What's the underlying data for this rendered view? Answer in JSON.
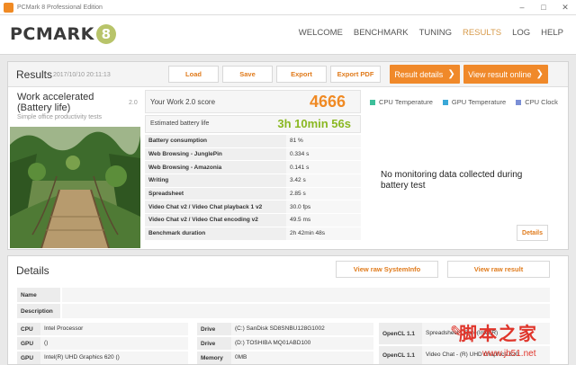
{
  "window": {
    "title": "PCMark 8 Professional Edition",
    "minimize": "–",
    "maximize": "□",
    "close": "✕"
  },
  "header": {
    "logo_text": "PCMARK",
    "logo_number": "8",
    "nav": [
      "WELCOME",
      "BENCHMARK",
      "TUNING",
      "RESULTS",
      "LOG",
      "HELP"
    ],
    "active_nav": "RESULTS"
  },
  "results": {
    "title": "Results",
    "date": "2017/10/10 20:11:13",
    "buttons": {
      "load": "Load",
      "save": "Save",
      "export": "Export",
      "export_pdf": "Export PDF",
      "result_details": "Result details",
      "view_online": "View result online"
    },
    "test_title": "Work accelerated (Battery life)",
    "test_version": "2.0",
    "test_subtitle": "Simple office productivity tests",
    "score_label": "Your Work 2.0 score",
    "score_value": "4666",
    "battery_label": "Estimated battery life",
    "battery_value": "3h 10min 56s",
    "metrics": [
      {
        "name": "Battery consumption",
        "value": "81 %"
      },
      {
        "name": "Web Browsing - JunglePin",
        "value": "0.334 s"
      },
      {
        "name": "Web Browsing - Amazonia",
        "value": "0.141 s"
      },
      {
        "name": "Writing",
        "value": "3.42 s"
      },
      {
        "name": "Spreadsheet",
        "value": "2.85 s"
      },
      {
        "name": "Video Chat v2 / Video Chat playback 1 v2",
        "value": "30.0 fps"
      },
      {
        "name": "Video Chat v2 / Video Chat encoding v2",
        "value": "49.5 ms"
      },
      {
        "name": "Benchmark duration",
        "value": "2h 42min 48s"
      }
    ],
    "legend": [
      {
        "label": "CPU Temperature",
        "color": "#3dbf9a"
      },
      {
        "label": "GPU Temperature",
        "color": "#3aa8d8"
      },
      {
        "label": "CPU Clock",
        "color": "#7b8fd6"
      }
    ],
    "no_monitoring": "No monitoring data collected during battery test",
    "details_button": "Details"
  },
  "details": {
    "title": "Details",
    "view_sysinfo": "View raw SystemInfo",
    "view_result": "View raw result",
    "name_label": "Name",
    "description_label": "Description",
    "col1": [
      {
        "k": "CPU",
        "v": "Intel Processor"
      },
      {
        "k": "GPU",
        "v": "()"
      },
      {
        "k": "GPU",
        "v": "Intel(R) UHD Graphics 620 ()"
      }
    ],
    "col2": [
      {
        "k": "Drive",
        "v": "(C:) SanDisk SD8SNBU128G1002"
      },
      {
        "k": "Drive",
        "v": "(D:) TOSHIBA MQ01ABD100"
      },
      {
        "k": "Memory",
        "v": "0MB"
      }
    ],
    "col3": [
      {
        "k": "OpenCL 1.1",
        "v": "Spreadsheet - Core(Intel(R)"
      },
      {
        "k": "OpenCL 1.1",
        "v": "Video Chat - (R) UHD Graphics 620"
      }
    ]
  },
  "watermark": {
    "text": "脚本之家",
    "url": "www.jb51.net"
  }
}
